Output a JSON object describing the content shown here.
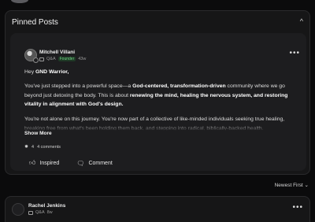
{
  "section": {
    "title": "Pinned Posts",
    "collapse_icon": "^"
  },
  "post": {
    "author": "Mitchell Villani",
    "category": "Q&A",
    "tag": "Founder",
    "age": "43w",
    "greeting_prefix": "Hey ",
    "greeting_bold": "GND Warrior",
    "greeting_suffix": ",",
    "p2_a": "You've just stepped into a powerful space—a ",
    "p2_b": "God-centered, transformation-driven",
    "p2_c": " community where we go beyond just detoxing the body. This is about ",
    "p2_d": "renewing the mind, healing the nervous system, and restoring vitality in alignment with God's design.",
    "p3": "You're not alone on this journey. You're now part of a collective of like-minded individuals seeking true healing, breaking free from what's been holding them back, and stepping into radical, biblically-backed health.",
    "show_more": "Show More",
    "reactions_count": "4",
    "comments_count": "4 comments",
    "inspired_label": "Inspired",
    "comment_label": "Comment"
  },
  "sort": {
    "label": "Newest First"
  },
  "next_post": {
    "author": "Rachel Jenkins",
    "category": "Q&A",
    "age": "8w"
  },
  "icons": {
    "more": "more-horizontal-icon",
    "qa": "qa-icon",
    "thumb": "thumbs-up-icon",
    "comment": "comment-icon",
    "chevron": "chevron-down-icon"
  }
}
